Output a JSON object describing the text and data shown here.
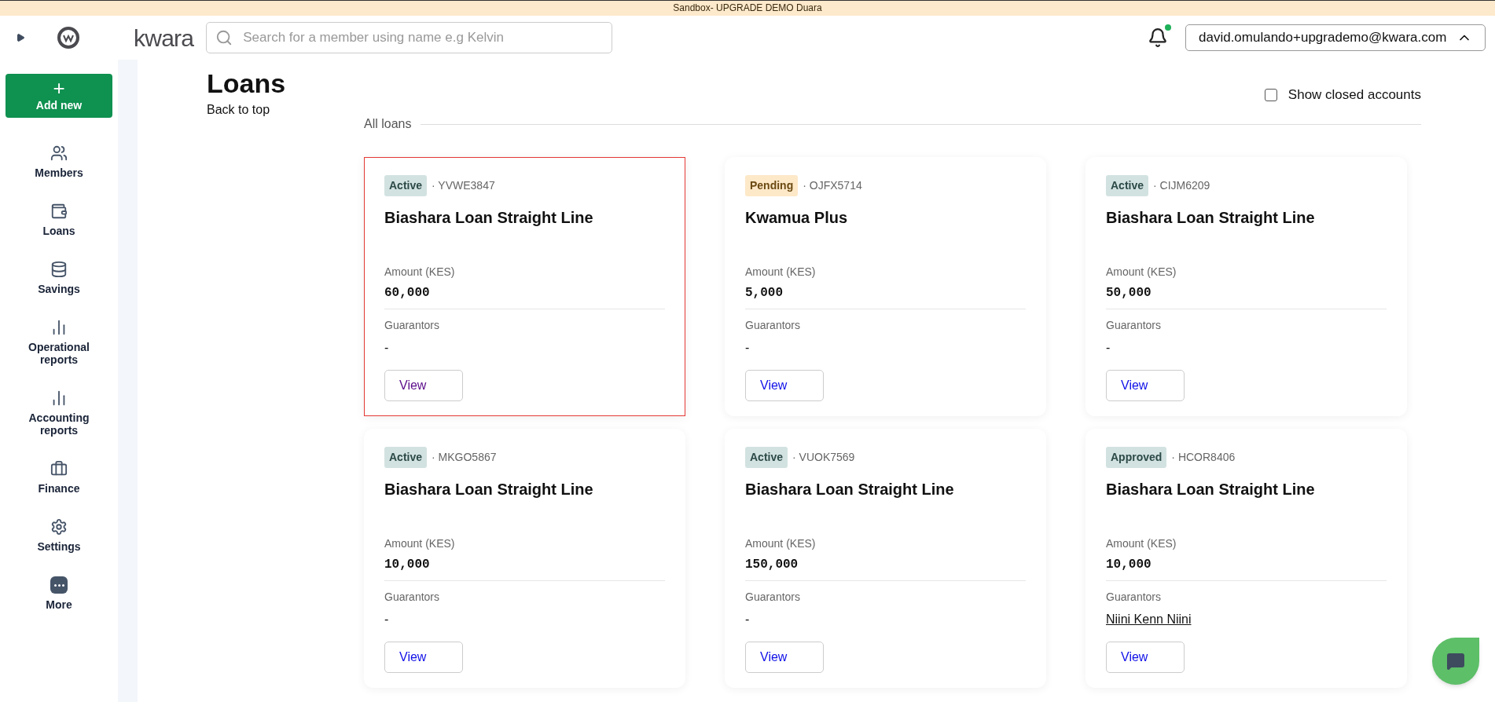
{
  "banner": "Sandbox- UPGRADE DEMO Duara",
  "header": {
    "brand": "kwara",
    "search": {
      "placeholder": "Search for a member using name e.g Kelvin"
    },
    "notification_dot": true,
    "user": "david.omulando+upgrademo@kwara.com"
  },
  "sidebar": {
    "add_button": {
      "icon": "+",
      "label": "Add new"
    },
    "items": [
      {
        "label": "Members"
      },
      {
        "label": "Loans"
      },
      {
        "label": "Savings"
      },
      {
        "label": "Operational reports"
      },
      {
        "label": "Accounting reports"
      },
      {
        "label": "Finance"
      },
      {
        "label": "Settings"
      },
      {
        "label": "More"
      }
    ]
  },
  "page": {
    "title": "Loans",
    "back_link": "Back to top",
    "show_closed": {
      "label": "Show closed accounts",
      "checked": false
    },
    "section": "All loans"
  },
  "loans": [
    {
      "status": "Active",
      "kind": "active",
      "id": "· YVWE3847",
      "name": "Biashara Loan Straight Line",
      "amount_label": "Amount (KES)",
      "amount": "60,000",
      "guarantors_label": "Guarantors",
      "guarantor": {
        "text": "-",
        "link": false
      },
      "button": "View",
      "selected": true,
      "visited": true
    },
    {
      "status": "Pending",
      "kind": "pending",
      "id": "· OJFX5714",
      "name": "Kwamua Plus",
      "amount_label": "Amount (KES)",
      "amount": "5,000",
      "guarantors_label": "Guarantors",
      "guarantor": {
        "text": "-",
        "link": false
      },
      "button": "View",
      "selected": false,
      "visited": false
    },
    {
      "status": "Active",
      "kind": "active",
      "id": "· CIJM6209",
      "name": "Biashara Loan Straight Line",
      "amount_label": "Amount (KES)",
      "amount": "50,000",
      "guarantors_label": "Guarantors",
      "guarantor": {
        "text": "-",
        "link": false
      },
      "button": "View",
      "selected": false,
      "visited": false
    },
    {
      "status": "Active",
      "kind": "active",
      "id": "· MKGO5867",
      "name": "Biashara Loan Straight Line",
      "amount_label": "Amount (KES)",
      "amount": "10,000",
      "guarantors_label": "Guarantors",
      "guarantor": {
        "text": "-",
        "link": false
      },
      "button": "View",
      "selected": false,
      "visited": false
    },
    {
      "status": "Active",
      "kind": "active",
      "id": "· VUOK7569",
      "name": "Biashara Loan Straight Line",
      "amount_label": "Amount (KES)",
      "amount": "150,000",
      "guarantors_label": "Guarantors",
      "guarantor": {
        "text": "-",
        "link": false
      },
      "button": "View",
      "selected": false,
      "visited": false
    },
    {
      "status": "Approved",
      "kind": "approved",
      "id": "· HCOR8406",
      "name": "Biashara Loan Straight Line",
      "amount_label": "Amount (KES)",
      "amount": "10,000",
      "guarantors_label": "Guarantors",
      "guarantor": {
        "text": "Niini Kenn Niini",
        "link": true
      },
      "button": "View",
      "selected": false,
      "visited": false
    }
  ]
}
